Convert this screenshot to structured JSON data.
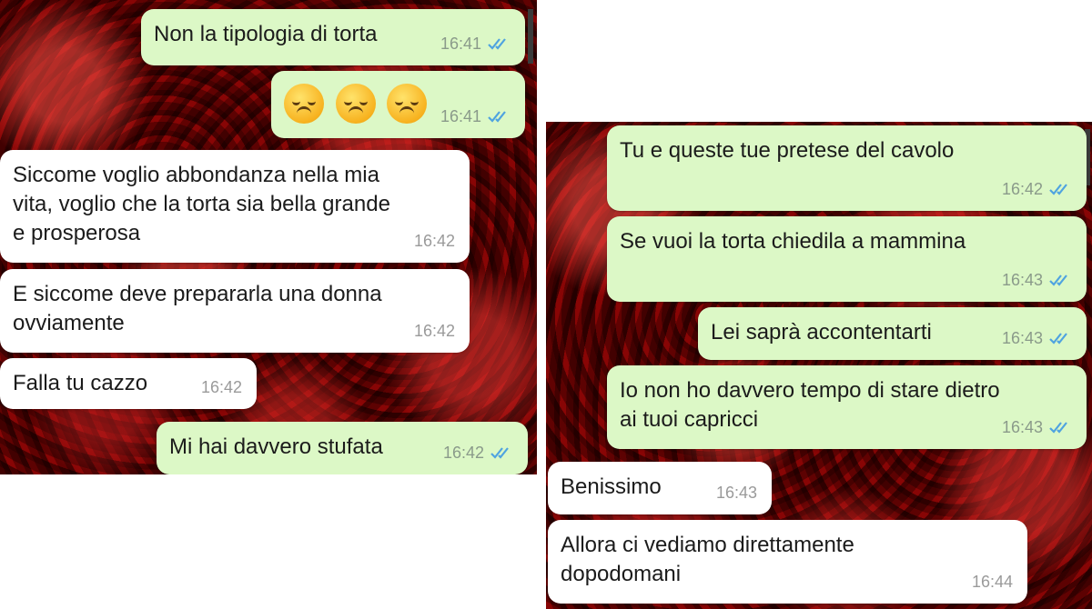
{
  "left_chat": {
    "messages": [
      {
        "text": "Non la tipologia di torta",
        "time": "16:41",
        "dir": "out",
        "read": true
      },
      {
        "text": "",
        "emoji": [
          "disappointed-face-icon",
          "disappointed-face-icon",
          "disappointed-face-icon"
        ],
        "time": "16:41",
        "dir": "out",
        "read": true
      },
      {
        "text": "Siccome voglio abbondanza nella mia\nvita, voglio che la torta sia bella grande\ne prosperosa",
        "time": "16:42",
        "dir": "in"
      },
      {
        "text": "E siccome deve prepararla una donna\novviamente",
        "time": "16:42",
        "dir": "in"
      },
      {
        "text": "Falla tu cazzo",
        "time": "16:42",
        "dir": "in"
      },
      {
        "text": "Mi hai davvero stufata",
        "time": "16:42",
        "dir": "out",
        "read": true
      }
    ]
  },
  "right_chat": {
    "messages": [
      {
        "text": "Tu e queste tue pretese del cavolo",
        "time": "16:42",
        "dir": "out",
        "read": true
      },
      {
        "text": "Se vuoi la torta chiedila a mammina",
        "time": "16:43",
        "dir": "out",
        "read": true
      },
      {
        "text": "Lei saprà accontentarti",
        "time": "16:43",
        "dir": "out",
        "read": true
      },
      {
        "text": "Io non ho davvero tempo di stare dietro\nai tuoi capricci",
        "time": "16:43",
        "dir": "out",
        "read": true
      },
      {
        "text": "Benissimo",
        "time": "16:43",
        "dir": "in"
      },
      {
        "text": "Allora ci vediamo direttamente\ndopodomani",
        "time": "16:44",
        "dir": "in"
      }
    ]
  },
  "colors": {
    "outgoing_bubble": "#dcf8c6",
    "incoming_bubble": "#ffffff",
    "read_ticks": "#4fa3e0",
    "wallpaper": "#8e1212"
  }
}
